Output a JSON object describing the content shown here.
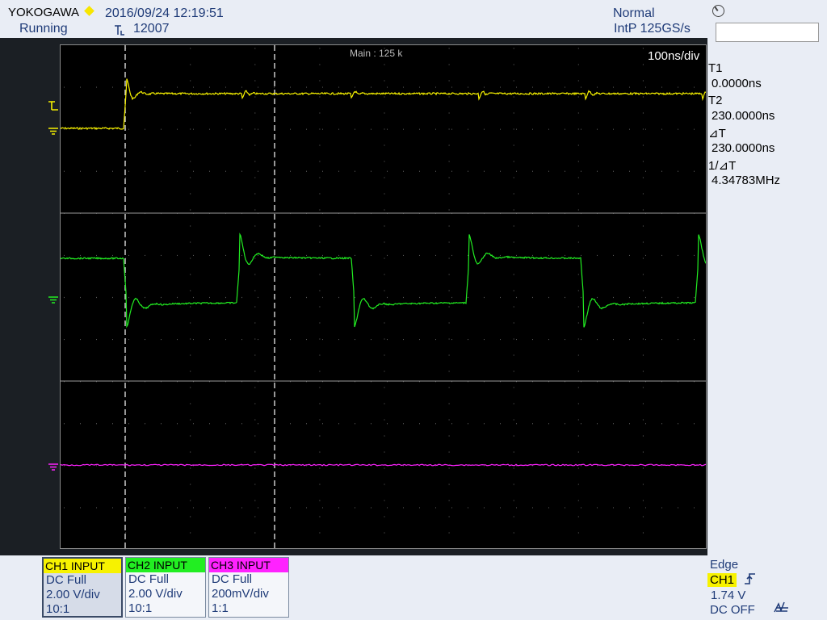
{
  "header": {
    "brand": "YOKOGAWA",
    "datetime": "2016/09/24 12:19:51",
    "run_state": "Running",
    "acq_count": "12007",
    "trigger_mode": "Normal",
    "sample_rate": "IntP  125GS/s"
  },
  "screen": {
    "main_label": "Main : 125 k",
    "timebase": "100ns/div"
  },
  "cursors": {
    "t1_label": "T1",
    "t1_value": "0.0000ns",
    "t2_label": "T2",
    "t2_value": "230.0000ns",
    "dt_label": "⊿T",
    "dt_value": "230.0000ns",
    "inv_dt_label": "1/⊿T",
    "inv_dt_value": "4.34783MHz"
  },
  "channels": [
    {
      "title": "CH1 INPUT",
      "coupling": "DC Full",
      "scale": "2.00 V/div",
      "probe": "10:1",
      "color": "#f7f200"
    },
    {
      "title": "CH2 INPUT",
      "coupling": "DC Full",
      "scale": "2.00 V/div",
      "probe": "10:1",
      "color": "#22ee22"
    },
    {
      "title": "CH3 INPUT",
      "coupling": "DC Full",
      "scale": "200mV/div",
      "probe": "1:1",
      "color": "#ff22ff"
    }
  ],
  "trigger": {
    "type": "Edge",
    "source": "CH1",
    "level": "1.74 V",
    "coupling": "DC OFF"
  },
  "icons": {
    "trigger_marker": "trigger-level-marker-icon",
    "ground": "ground-marker-icon",
    "rising_edge": "rising-edge-icon",
    "noise_filter": "noise-filter-icon"
  }
}
